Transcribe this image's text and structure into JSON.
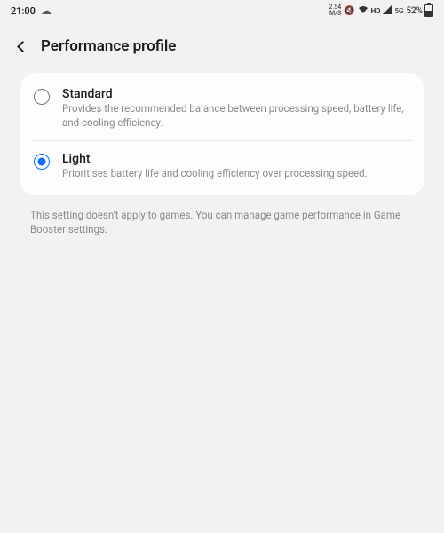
{
  "status": {
    "time": "21:00",
    "net_speed_top": "2.54",
    "net_speed_bottom": "M/S",
    "hd_label": "HD",
    "net_label": "5G",
    "battery_pct": "52%"
  },
  "header": {
    "title": "Performance profile"
  },
  "options": [
    {
      "title": "Standard",
      "desc": "Provides the recommended balance between processing speed, battery life, and cooling efficiency.",
      "selected": false
    },
    {
      "title": "Light",
      "desc": "Prioritises battery life and cooling efficiency over processing speed.",
      "selected": true
    }
  ],
  "footer": "This setting doesn't apply to games. You can manage game performance in Game Booster settings."
}
